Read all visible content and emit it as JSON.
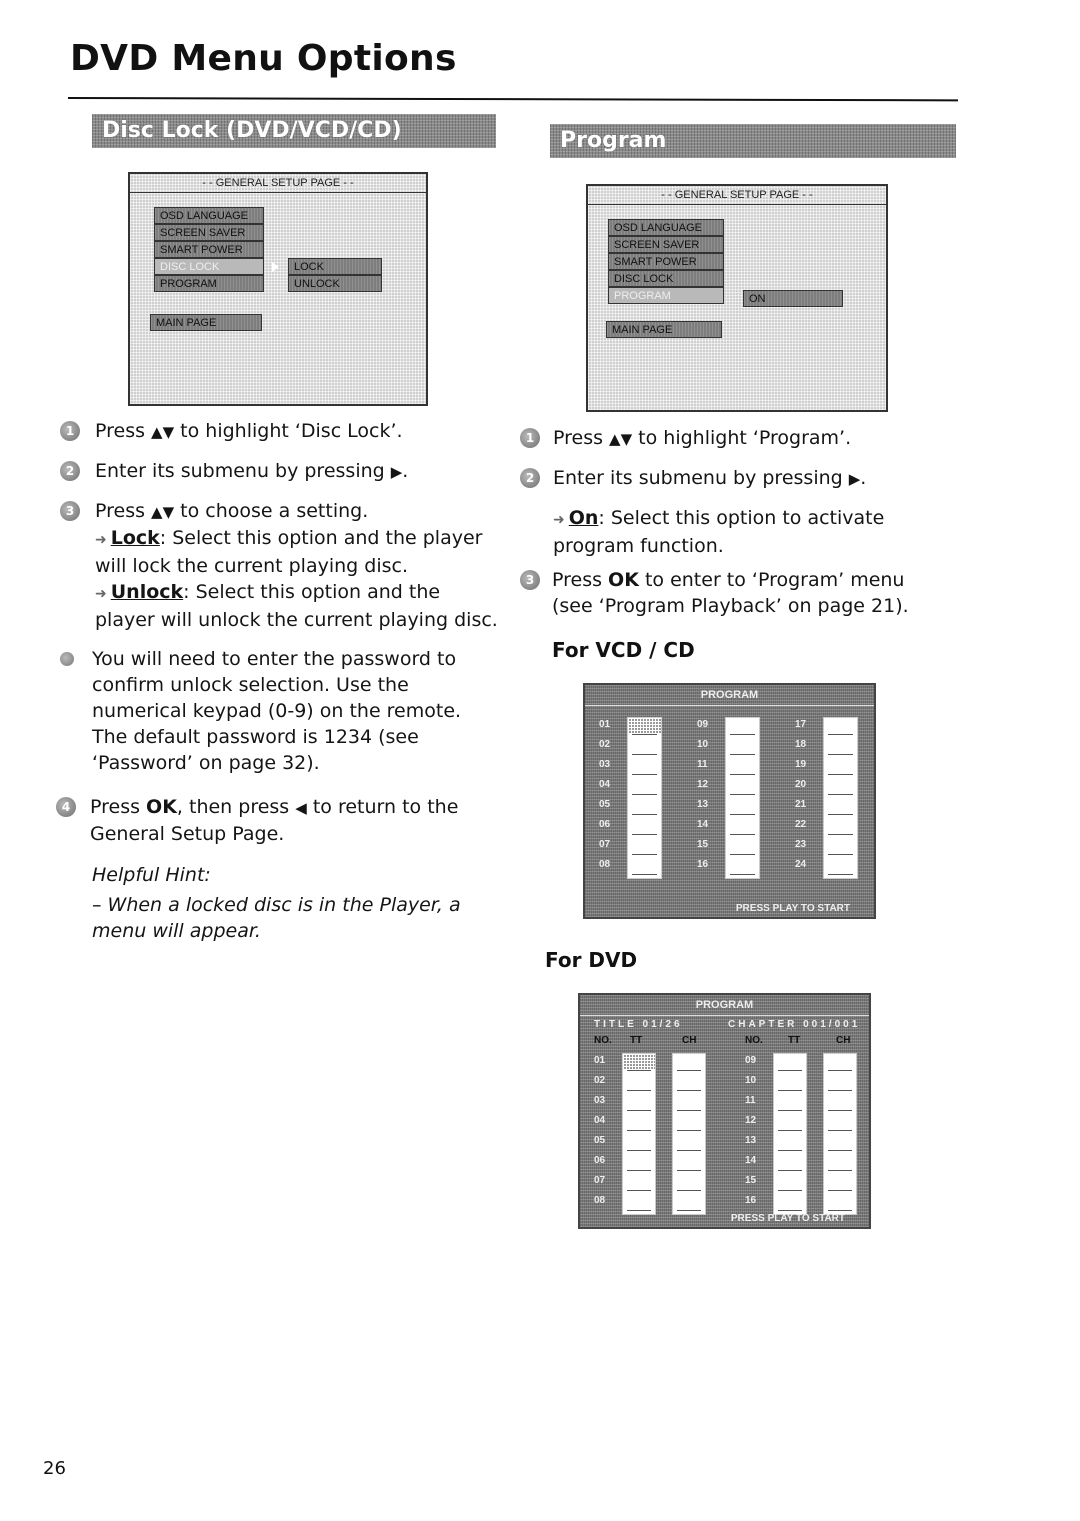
{
  "page": {
    "title": "DVD Menu Options",
    "page_number": "26"
  },
  "disc_lock": {
    "section_title": "Disc Lock (DVD/VCD/CD)",
    "osd": {
      "header": "- - GENERAL SETUP PAGE - -",
      "menu_items": [
        "OSD LANGUAGE",
        "SCREEN SAVER",
        "SMART POWER",
        "DISC LOCK",
        "PROGRAM"
      ],
      "active_item": "DISC LOCK",
      "main_page": "MAIN PAGE",
      "submenu": [
        "LOCK",
        "UNLOCK"
      ]
    },
    "steps": [
      {
        "number": "1",
        "text_before": "Press ",
        "keys": "▲▼",
        "text_after": " to highlight ‘Disc Lock’."
      },
      {
        "number": "2",
        "text_before": "Enter its submenu by pressing ",
        "keys": "▶",
        "text_after": "."
      },
      {
        "number": "3",
        "text_before": "Press ",
        "keys": "▲▼",
        "text_after": " to choose a setting."
      }
    ],
    "options": [
      {
        "label": "Lock",
        "text": ": Select this option and the player will lock the current playing disc."
      },
      {
        "label": "Unlock",
        "text": ": Select this option and the player will unlock the current playing disc."
      }
    ],
    "note": "You will need to enter the password to confirm unlock selection.  Use the numerical keypad (0-9) on the remote. The default password is 1234 (see ‘Password’ on page 32).",
    "step4": {
      "number": "4",
      "text_before": "Press ",
      "bold": "OK",
      "text_mid": ", then press ",
      "keys": "◀",
      "text_after": " to return to the General Setup Page."
    },
    "hint_title": "Helpful Hint:",
    "hint_text": "–    When a locked disc is in the Player, a menu will appear."
  },
  "program": {
    "section_title": "Program",
    "osd": {
      "header": "- - GENERAL SETUP PAGE - -",
      "menu_items": [
        "OSD LANGUAGE",
        "SCREEN SAVER",
        "SMART POWER",
        "DISC LOCK",
        "PROGRAM"
      ],
      "active_item": "PROGRAM",
      "main_page": "MAIN PAGE",
      "submenu": [
        "ON"
      ]
    },
    "steps": [
      {
        "number": "1",
        "text_before": "Press ",
        "keys": "▲▼",
        "text_after": " to highlight ‘Program’."
      },
      {
        "number": "2",
        "text_before": "Enter its submenu by pressing ",
        "keys": "▶",
        "text_after": "."
      }
    ],
    "option_on": {
      "label": "On",
      "text": ": Select this option to activate program function."
    },
    "step3": {
      "number": "3",
      "text_before": "Press ",
      "bold": "OK",
      "text_after": " to enter to ‘Program’ menu (see ‘Program Playback’ on page 21)."
    },
    "vcd_heading": "For VCD / CD",
    "vcd_screen": {
      "header": "PROGRAM",
      "columns": [
        [
          "01",
          "02",
          "03",
          "04",
          "05",
          "06",
          "07",
          "08"
        ],
        [
          "09",
          "10",
          "11",
          "12",
          "13",
          "14",
          "15",
          "16"
        ],
        [
          "17",
          "18",
          "19",
          "20",
          "21",
          "22",
          "23",
          "24"
        ]
      ],
      "footer": "PRESS PLAY TO START"
    },
    "dvd_heading": "For DVD",
    "dvd_screen": {
      "header": "PROGRAM",
      "title_info": "TITLE 01/26",
      "chapter_info": "CHAPTER 001/001",
      "col_headers": [
        "NO.",
        "TT",
        "CH",
        "NO.",
        "TT",
        "CH"
      ],
      "columns": [
        [
          "01",
          "02",
          "03",
          "04",
          "05",
          "06",
          "07",
          "08"
        ],
        [
          "09",
          "10",
          "11",
          "12",
          "13",
          "14",
          "15",
          "16"
        ]
      ],
      "footer": "PRESS PLAY TO START"
    }
  }
}
